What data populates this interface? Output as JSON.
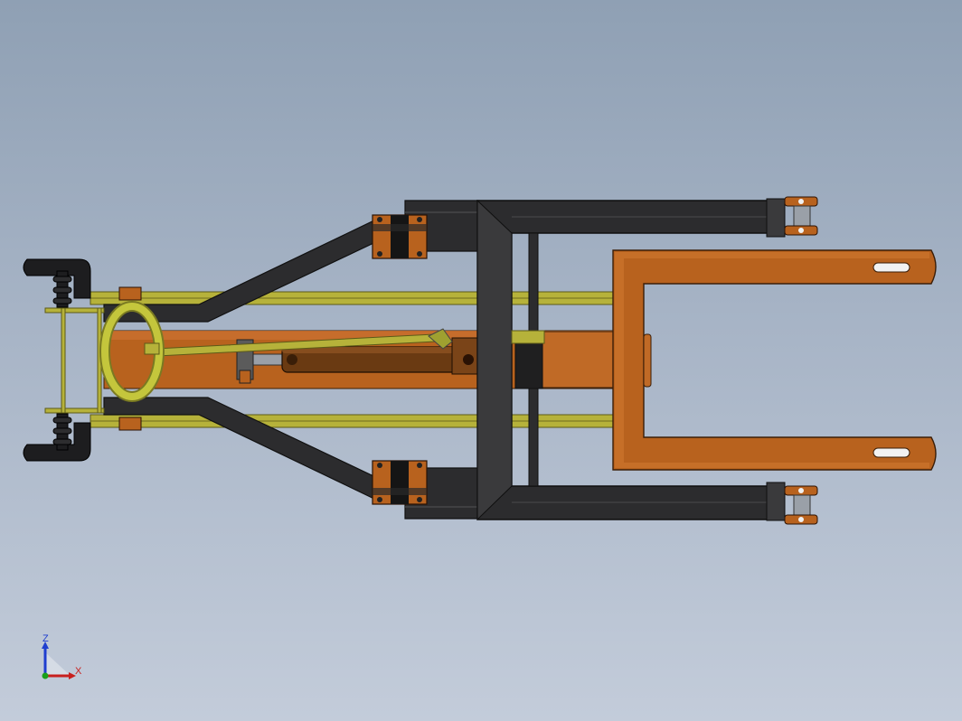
{
  "viewport": {
    "background_top": "#8fa0b4",
    "background_bottom": "#c3ccda"
  },
  "colors": {
    "frame_dark": "#2c2c2e",
    "frame_dark_edge": "#111111",
    "steel_orange": "#b8621e",
    "steel_orange_light": "#d27a32",
    "rail_olive": "#b6b23a",
    "rail_olive_dark": "#6e6b1e",
    "handle_yellow": "#c4c63c",
    "cylinder_brown": "#6a3a12",
    "rod_gray": "#9aa0a8"
  },
  "triad": {
    "z_label": "Z",
    "x_label": "X",
    "z_color": "#1f3ecf",
    "x_color": "#c8201e",
    "y_color": "#1aa01a"
  }
}
